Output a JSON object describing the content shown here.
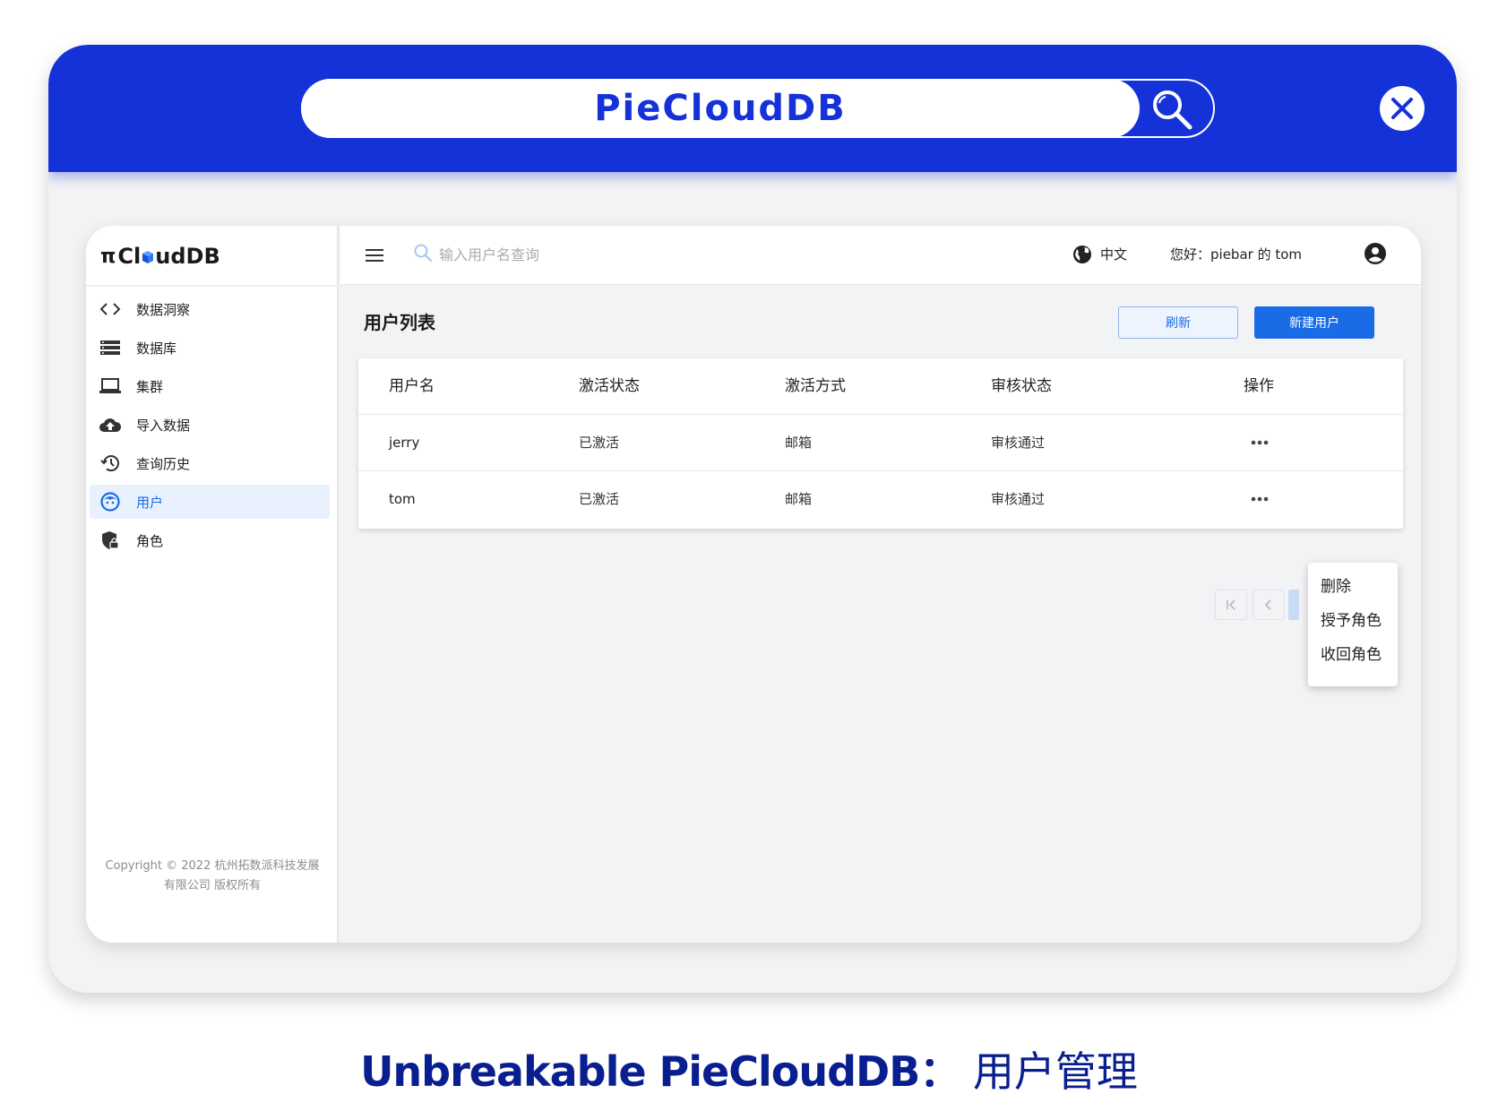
{
  "banner": {
    "title": "PieCloudDB"
  },
  "app": {
    "logo": {
      "pi": "π",
      "text_left": "Cl",
      "text_right": "udDB"
    },
    "sidebar": {
      "items": [
        {
          "label": "数据洞察",
          "icon": "code-icon"
        },
        {
          "label": "数据库",
          "icon": "database-icon"
        },
        {
          "label": "集群",
          "icon": "laptop-icon"
        },
        {
          "label": "导入数据",
          "icon": "cloud-upload-icon"
        },
        {
          "label": "查询历史",
          "icon": "history-icon"
        },
        {
          "label": "用户",
          "icon": "user-face-icon",
          "active": true
        },
        {
          "label": "角色",
          "icon": "shield-lock-icon"
        }
      ],
      "copyright_line1": "Copyright © 2022 杭州拓数派科技发展",
      "copyright_line2": "有限公司 版权所有"
    },
    "topbar": {
      "search_placeholder": "输入用户名查询",
      "language": "中文",
      "greeting": "您好：piebar 的 tom"
    },
    "page_title": "用户列表",
    "buttons": {
      "refresh": "刷新",
      "new_user": "新建用户"
    },
    "table": {
      "columns": [
        "用户名",
        "激活状态",
        "激活方式",
        "审核状态",
        "操作"
      ],
      "rows": [
        {
          "username": "jerry",
          "activation_status": "已激活",
          "activation_method": "邮箱",
          "review_status": "审核通过"
        },
        {
          "username": "tom",
          "activation_status": "已激活",
          "activation_method": "邮箱",
          "review_status": "审核通过"
        }
      ]
    },
    "row_menu": {
      "items": [
        "删除",
        "授予角色",
        "收回角色"
      ]
    }
  },
  "caption": {
    "bold": "Unbreakable PieCloudDB",
    "separator": "：",
    "light": "用户管理"
  },
  "colors": {
    "banner": "#1432d8",
    "accent": "#1a6be6",
    "caption": "#0a1f8f"
  }
}
